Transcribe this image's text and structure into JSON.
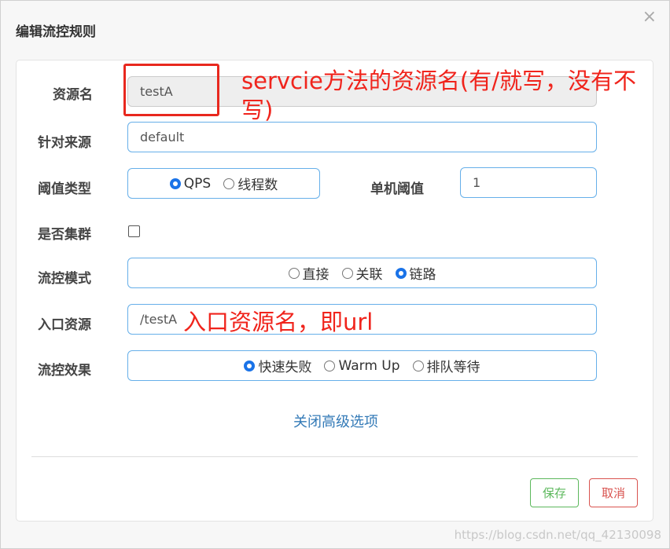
{
  "dialog": {
    "title": "编辑流控规则",
    "close_glyph": "×"
  },
  "form": {
    "resource_label": "资源名",
    "resource_value": "testA",
    "source_label": "针对来源",
    "source_value": "default",
    "threshold_type_label": "阈值类型",
    "threshold_type_options": [
      "QPS",
      "线程数"
    ],
    "single_threshold_label": "单机阈值",
    "single_threshold_value": "1",
    "cluster_label": "是否集群",
    "mode_label": "流控模式",
    "mode_options": [
      "直接",
      "关联",
      "链路"
    ],
    "entry_label": "入口资源",
    "entry_value": "/testA",
    "effect_label": "流控效果",
    "effect_options": [
      "快速失败",
      "Warm Up",
      "排队等待"
    ]
  },
  "advanced_link": "关闭高级选项",
  "buttons": {
    "save": "保存",
    "cancel": "取消"
  },
  "annotations": {
    "note1": "servcie方法的资源名(有/就写，没有不写)",
    "note2": "入口资源名，即url"
  },
  "watermark": "https://blog.csdn.net/qq_42130098",
  "colors": {
    "annotation": "#f0241c",
    "link": "#337ab7",
    "save": "#5cb85c",
    "cancel": "#d9534f"
  }
}
